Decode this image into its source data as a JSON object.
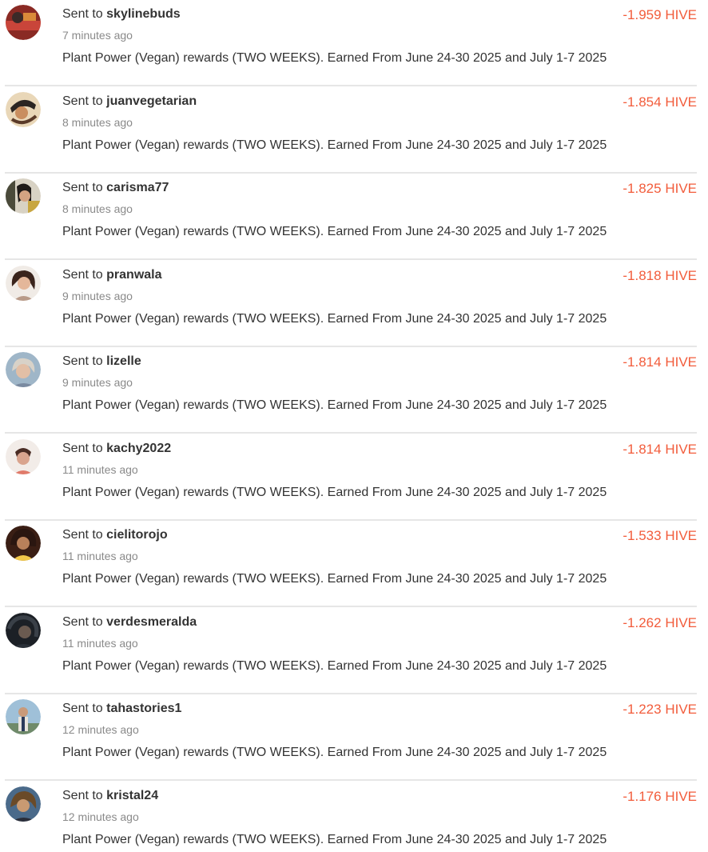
{
  "accent_color": "#f25c3b",
  "transactions": [
    {
      "prefix": "Sent to ",
      "recipient": "skylinebuds",
      "time": "7 minutes ago",
      "memo": "Plant Power (Vegan) rewards (TWO WEEKS). Earned From June 24-30 2025 and July 1-7 2025",
      "amount": "-1.959 HIVE"
    },
    {
      "prefix": "Sent to ",
      "recipient": "juanvegetarian",
      "time": "8 minutes ago",
      "memo": "Plant Power (Vegan) rewards (TWO WEEKS). Earned From June 24-30 2025 and July 1-7 2025",
      "amount": "-1.854 HIVE"
    },
    {
      "prefix": "Sent to ",
      "recipient": "carisma77",
      "time": "8 minutes ago",
      "memo": "Plant Power (Vegan) rewards (TWO WEEKS). Earned From June 24-30 2025 and July 1-7 2025",
      "amount": "-1.825 HIVE"
    },
    {
      "prefix": "Sent to ",
      "recipient": "pranwala",
      "time": "9 minutes ago",
      "memo": "Plant Power (Vegan) rewards (TWO WEEKS). Earned From June 24-30 2025 and July 1-7 2025",
      "amount": "-1.818 HIVE"
    },
    {
      "prefix": "Sent to ",
      "recipient": "lizelle",
      "time": "9 minutes ago",
      "memo": "Plant Power (Vegan) rewards (TWO WEEKS). Earned From June 24-30 2025 and July 1-7 2025",
      "amount": "-1.814 HIVE"
    },
    {
      "prefix": "Sent to ",
      "recipient": "kachy2022",
      "time": "11 minutes ago",
      "memo": "Plant Power (Vegan) rewards (TWO WEEKS). Earned From June 24-30 2025 and July 1-7 2025",
      "amount": "-1.814 HIVE"
    },
    {
      "prefix": "Sent to ",
      "recipient": "cielitorojo",
      "time": "11 minutes ago",
      "memo": "Plant Power (Vegan) rewards (TWO WEEKS). Earned From June 24-30 2025 and July 1-7 2025",
      "amount": "-1.533 HIVE"
    },
    {
      "prefix": "Sent to ",
      "recipient": "verdesmeralda",
      "time": "11 minutes ago",
      "memo": "Plant Power (Vegan) rewards (TWO WEEKS). Earned From June 24-30 2025 and July 1-7 2025",
      "amount": "-1.262 HIVE"
    },
    {
      "prefix": "Sent to ",
      "recipient": "tahastories1",
      "time": "12 minutes ago",
      "memo": "Plant Power (Vegan) rewards (TWO WEEKS). Earned From June 24-30 2025 and July 1-7 2025",
      "amount": "-1.223 HIVE"
    },
    {
      "prefix": "Sent to ",
      "recipient": "kristal24",
      "time": "12 minutes ago",
      "memo": "Plant Power (Vegan) rewards (TWO WEEKS). Earned From June 24-30 2025 and July 1-7 2025",
      "amount": "-1.176 HIVE"
    }
  ]
}
